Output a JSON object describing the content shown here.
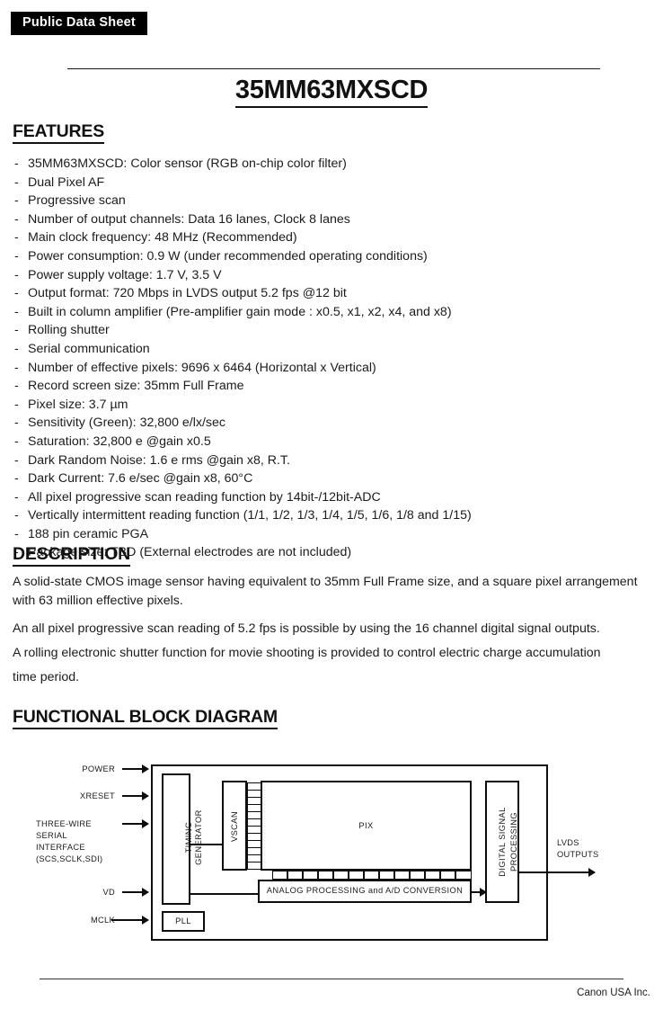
{
  "badge": {
    "label": "Public Data Sheet"
  },
  "title": "35MM63MXSCD",
  "sections": {
    "features_heading": "FEATURES",
    "description_heading": "DESCRIPTION",
    "diagram_heading": "FUNCTIONAL BLOCK DIAGRAM"
  },
  "features": {
    "bullet": "-",
    "items": [
      "35MM63MXSCD: Color sensor (RGB on-chip color filter)",
      "Dual Pixel AF",
      "Progressive scan",
      "Number of output channels: Data 16 lanes, Clock 8 lanes",
      "Main clock frequency: 48 MHz (Recommended)",
      "Power consumption: 0.9 W (under recommended operating conditions)",
      "Power supply voltage: 1.7 V, 3.5 V",
      "Output format: 720 Mbps in LVDS output 5.2 fps @12 bit",
      "Built in column amplifier (Pre-amplifier gain mode : x0.5, x1, x2, x4, and x8)",
      "Rolling shutter",
      "Serial communication",
      "Number of effective pixels: 9696 x 6464 (Horizontal x Vertical)",
      "Record screen size: 35mm Full Frame",
      "Pixel size: 3.7 µm",
      "Sensitivity (Green): 32,800 e/lx/sec",
      "Saturation: 32,800 e @gain x0.5",
      "Dark Random Noise: 1.6 e rms @gain x8, R.T.",
      "Dark Current: 7.6 e/sec @gain x8, 60°C",
      "All pixel progressive scan reading function by 14bit-/12bit-ADC",
      "Vertically intermittent reading function (1/1, 1/2, 1/3, 1/4, 1/5, 1/6, 1/8 and 1/15)",
      "188 pin ceramic PGA",
      "Package size: TBD (External electrodes are not included)"
    ]
  },
  "description": {
    "para1_line1": "A solid-state CMOS image sensor having equivalent to 35mm Full Frame size, and a square pixel arrangement",
    "para1_line2": "with 63 million effective pixels.",
    "para2": "An all pixel progressive scan reading of 5.2 fps is possible by using the 16 channel digital signal outputs.",
    "para3_line1": "A rolling electronic shutter function for movie shooting is provided to control electric charge accumulation",
    "para3_line2": "time period."
  },
  "diagram": {
    "inputs": [
      {
        "label": "POWER"
      },
      {
        "label": "XRESET"
      },
      {
        "label": "THREE-WIRE"
      },
      {
        "label": "SERIAL"
      },
      {
        "label": "INTERFACE"
      },
      {
        "label": "(SCS,SCLK,SDI)"
      },
      {
        "label": "VD"
      },
      {
        "label": "MCLK"
      }
    ],
    "blocks": {
      "timing_generator_line1": "TIMING",
      "timing_generator_line2": "GENERATOR",
      "pll": "PLL",
      "vscan": "VSCAN",
      "pix": "PIX",
      "analog": "ANALOG PROCESSING and A/D CONVERSION",
      "dsp_line1": "DIGITAL SIGNAL",
      "dsp_line2": "PROCESSING"
    },
    "output_line1": "LVDS",
    "output_line2": "OUTPUTS"
  },
  "footer": {
    "company": "Canon USA Inc."
  }
}
